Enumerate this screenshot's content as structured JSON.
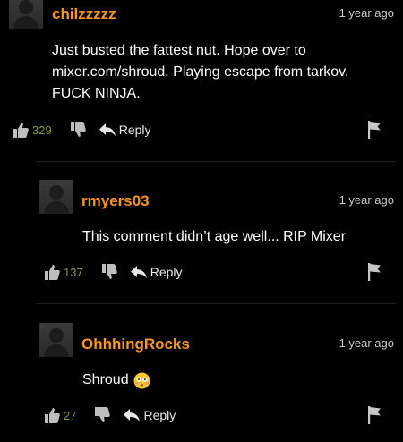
{
  "comments": [
    {
      "username": "chilzzzzz",
      "time": "1 year ago",
      "text": "Just busted the fattest nut. Hope over to mixer.com/shroud. Playing escape from tarkov. FUCK NINJA.",
      "likes": "329",
      "reply_label": "Reply"
    },
    {
      "username": "rmyers03",
      "time": "1 year ago",
      "text": "This comment didn’t age well... RIP Mixer",
      "likes": "137",
      "reply_label": "Reply"
    },
    {
      "username": "OhhhingRocks",
      "time": "1 year ago",
      "text": "Shroud",
      "emoji": "😳",
      "likes": "27",
      "reply_label": "Reply"
    }
  ],
  "colors": {
    "username": "#f7971d",
    "likes": "#7f9c41",
    "background": "#000000"
  }
}
